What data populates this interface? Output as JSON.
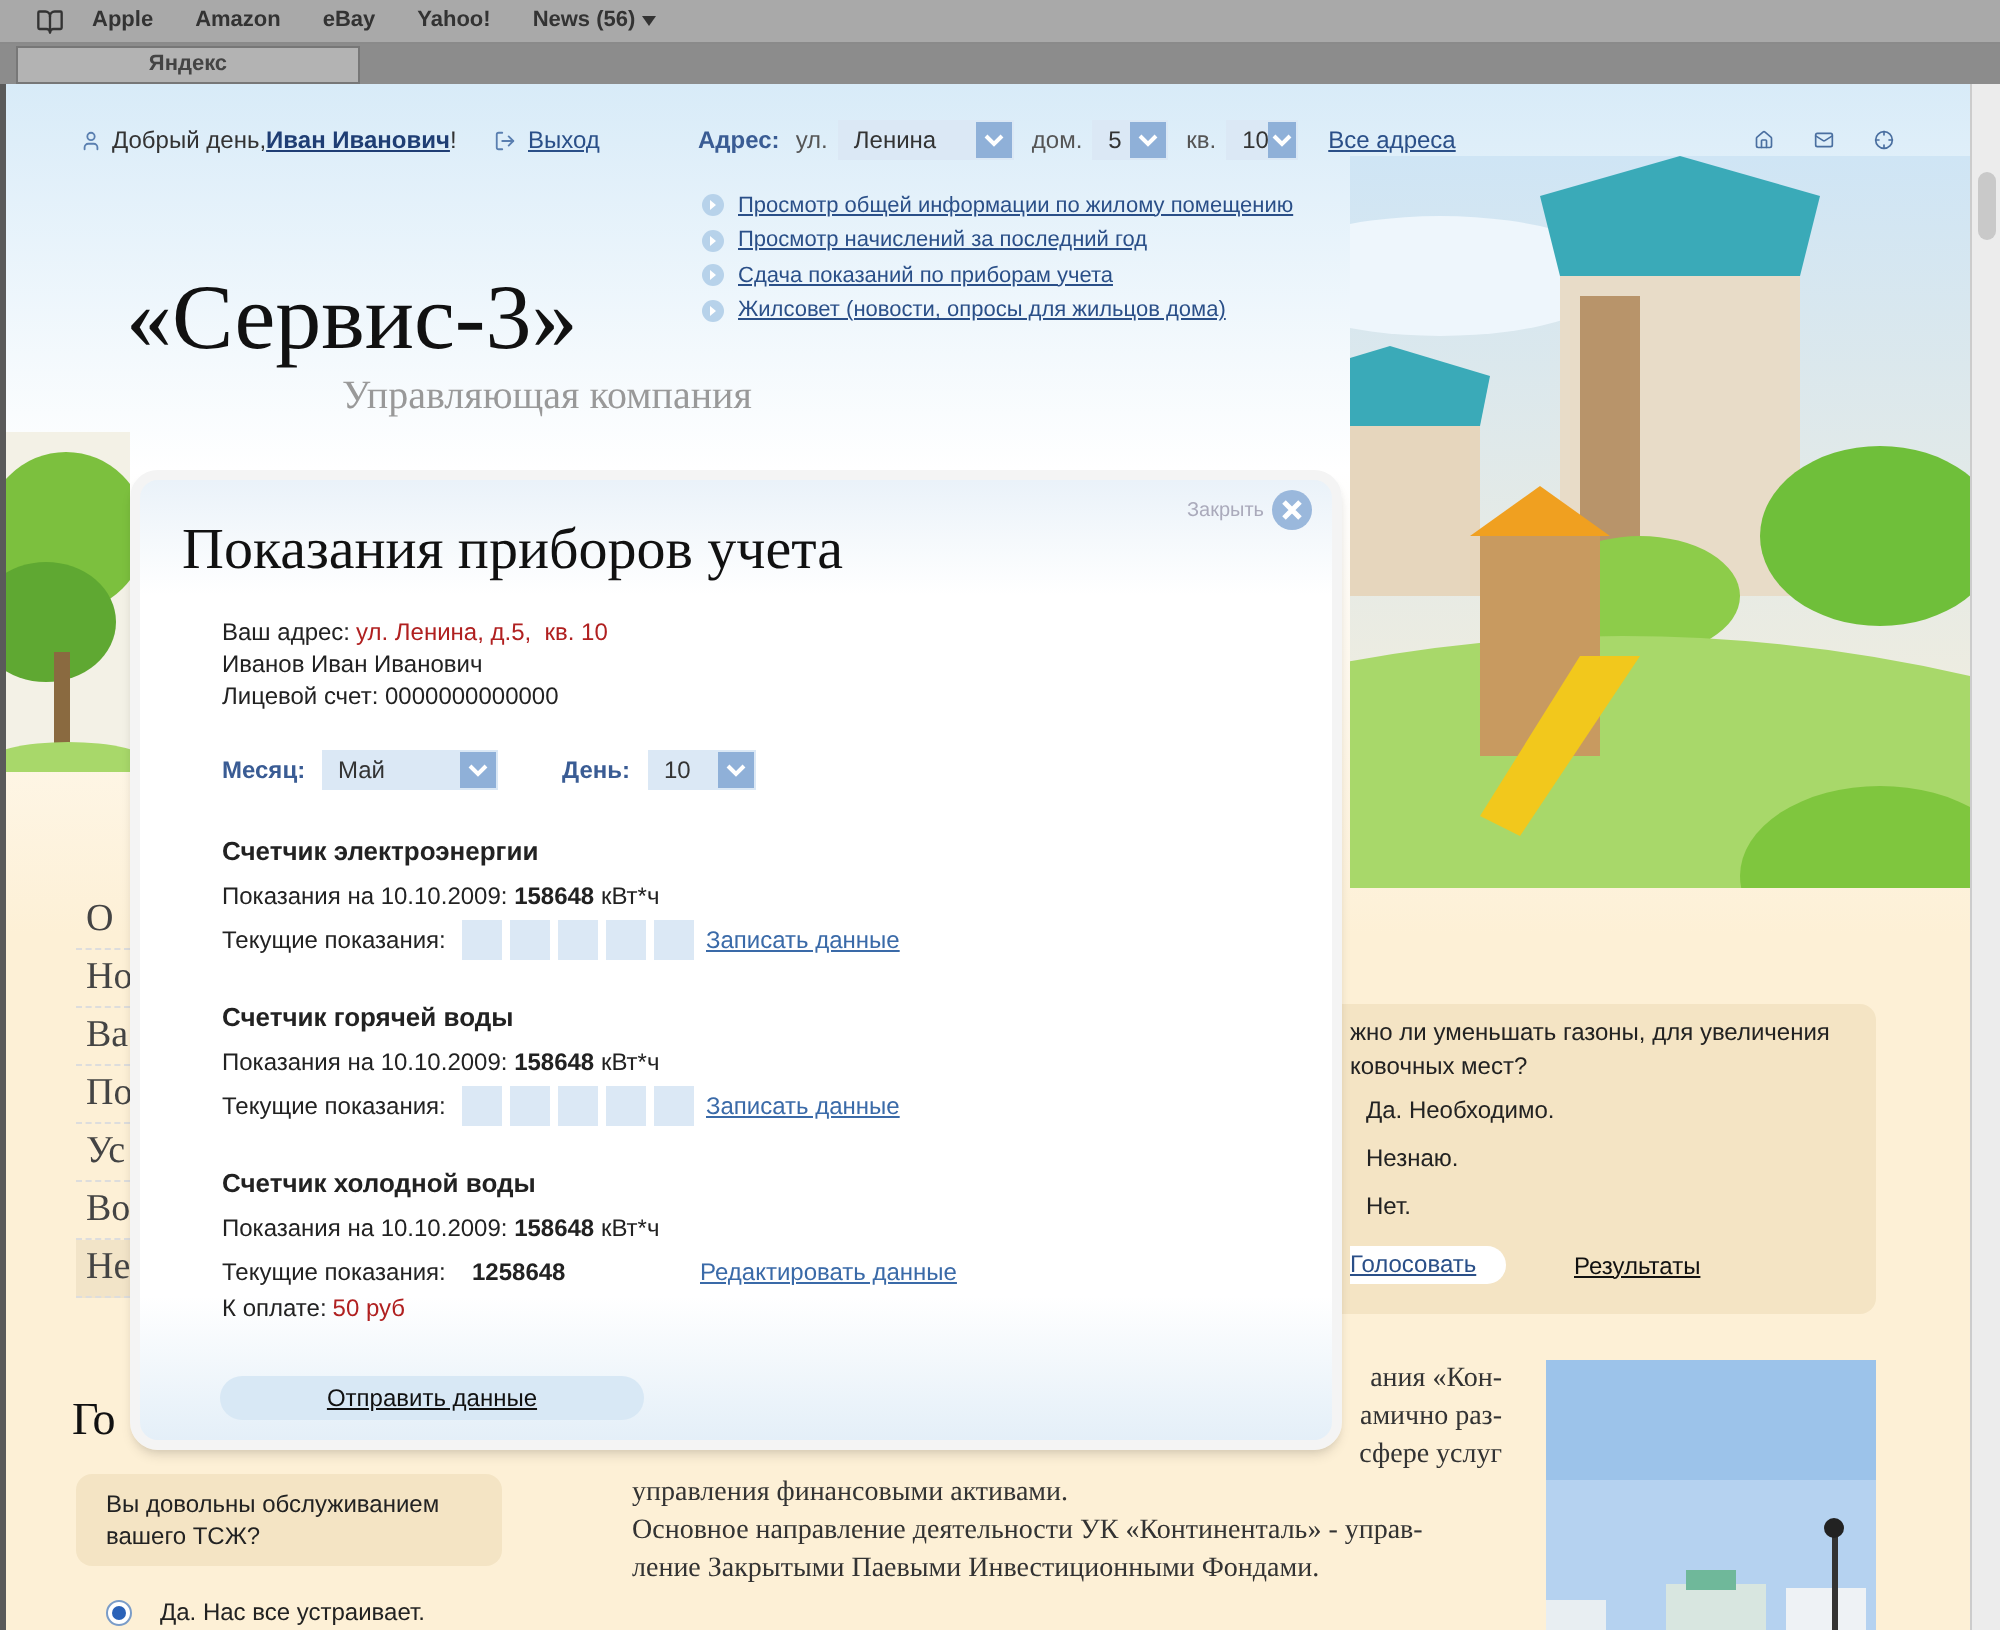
{
  "browser": {
    "bookmarks": [
      {
        "label": "Apple",
        "kind": "link"
      },
      {
        "label": "Amazon",
        "kind": "link"
      },
      {
        "label": "eBay",
        "kind": "link"
      },
      {
        "label": "Yahoo!",
        "kind": "link"
      },
      {
        "label": "News (56)",
        "kind": "menu"
      }
    ],
    "tabs": [
      {
        "label": "Яндекс",
        "selected": true
      }
    ]
  },
  "header": {
    "greeting": "Добрый день, ",
    "user": "Иван Иванович",
    "greeting_end": "!",
    "logout": "Выход",
    "address": {
      "label": "Адрес:",
      "street_label": "ул.",
      "street": "Ленина",
      "house_label": "дом.",
      "house": "5",
      "flat_label": "кв.",
      "flat": "10",
      "all_link": "Все адреса"
    }
  },
  "nav_links": [
    "Просмотр общей информации по жилому помещению",
    "Просмотр начислений за последний год",
    "Сдача показаний по приборам учета",
    "Жилсовет (новости, опросы для жильцов дома)"
  ],
  "logo": {
    "title": "«Сервис-3»",
    "subtitle": "Управляющая компания"
  },
  "side_menu": [
    {
      "label": "О",
      "selected": false
    },
    {
      "label": "Но",
      "selected": false
    },
    {
      "label": "Ва",
      "selected": false
    },
    {
      "label": "По",
      "selected": false
    },
    {
      "label": "Ус",
      "selected": false
    },
    {
      "label": "Во",
      "selected": false
    },
    {
      "label": "Не",
      "selected": true
    }
  ],
  "section_heading": "Го",
  "left_poll": {
    "question": "Вы довольны обслуживанием вашего ТСЖ?",
    "options": [
      {
        "label": "Да. Нас все устраивает.",
        "selected": true
      }
    ]
  },
  "right_poll": {
    "question_lines": [
      "жно ли уменьшать газоны, для увеличения",
      "ковочных мест?"
    ],
    "options": [
      "Да. Необходимо.",
      "Незнаю.",
      "Нет."
    ],
    "vote": "Голосовать",
    "results": "Результаты"
  },
  "article": {
    "cut_lines": [
      "ания «Кон-",
      "амично раз-",
      "сфере услуг"
    ],
    "lines": [
      "управления финансовыми активами.",
      "Основное направление деятельности УК «Континенталь» - управ-",
      "ление Закрытыми Паевыми Инвестиционными Фондами."
    ]
  },
  "modal": {
    "title": "Показания приборов учета",
    "close": "Закрыть",
    "address_label": "Ваш адрес:",
    "address": "ул. Ленина, д.5,  кв. 10",
    "name": "Иванов Иван Иванович",
    "account": "Лицевой счет: 0000000000000",
    "month_label": "Месяц:",
    "month": "Май",
    "day_label": "День:",
    "day": "10",
    "meters": [
      {
        "kind": "entry",
        "title": "Счетчик электроэнергии",
        "reading": "Показания на 10.10.2009: **158648** кВт*ч",
        "current_label": "Текущие показания:",
        "action": "Записать данные"
      },
      {
        "kind": "entry",
        "title": "Счетчик горячей воды",
        "reading": "Показания на 10.10.2009: **158648** кВт*ч",
        "current_label": "Текущие показания:",
        "action": "Записать данные"
      },
      {
        "kind": "entered",
        "title": "Счетчик холодной воды",
        "reading": "Показания на 10.10.2009: **158648** кВт*ч",
        "current_label": "Текущие показания:",
        "current_value": "1258648",
        "action": "Редактировать данные",
        "payment_label": "К оплате:",
        "payment": "50 руб"
      }
    ],
    "submit": "Отправить данные"
  }
}
